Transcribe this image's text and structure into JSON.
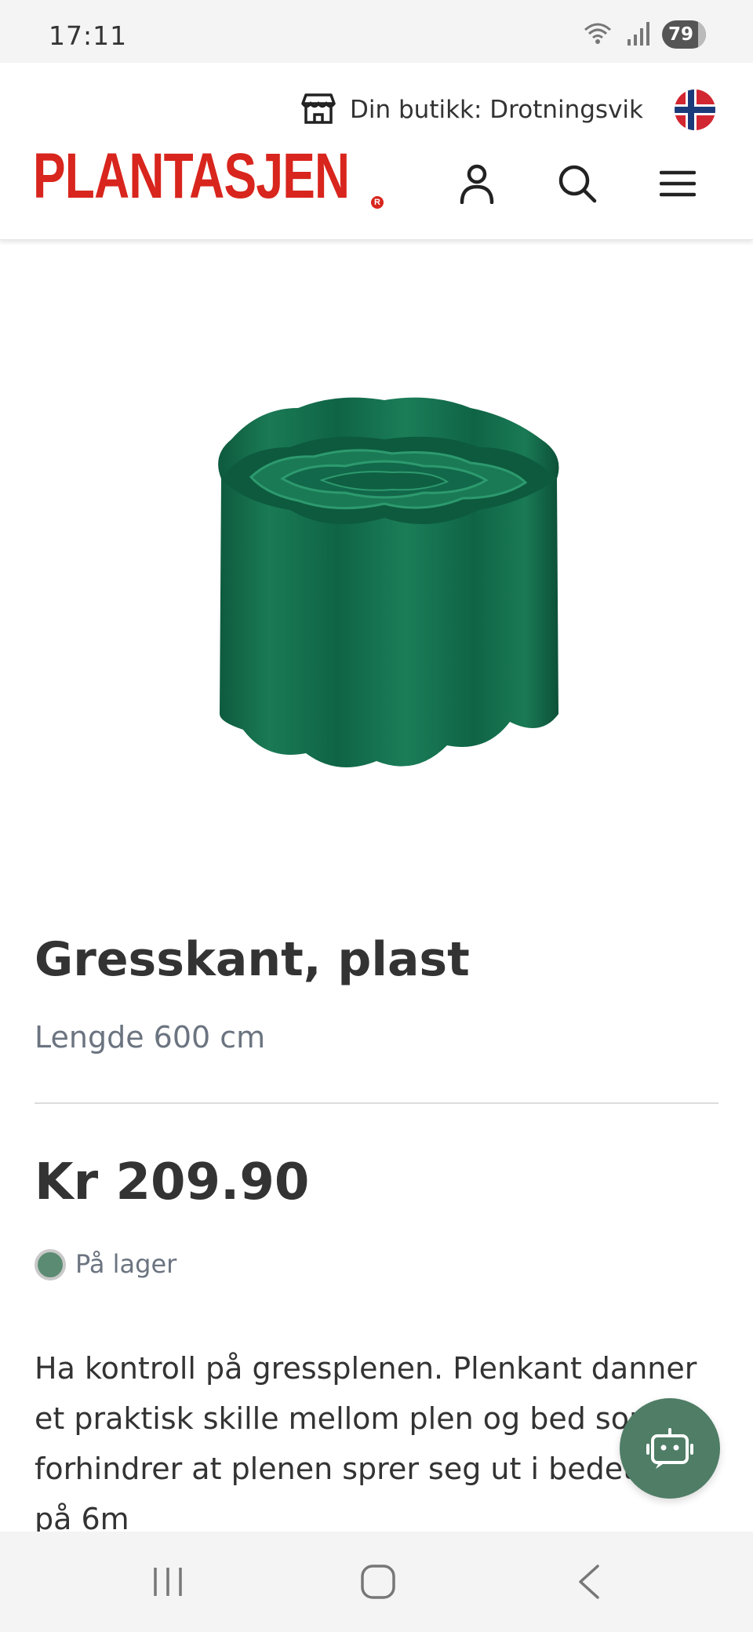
{
  "status_bar": {
    "time": "17:11",
    "battery": "79"
  },
  "header": {
    "store_label": "Din butikk: Drotningsvik",
    "logo_text": "PLANTASJEN",
    "icons": [
      "store-icon",
      "norway-flag-icon",
      "user-icon",
      "search-icon",
      "menu-icon"
    ]
  },
  "product": {
    "title": "Gresskant, plast",
    "subtitle": "Lengde 600 cm",
    "price": "Kr 209.90",
    "stock": "På lager",
    "description": "Ha kontroll på gressplenen. Plenkant danner et praktisk skille mellom plen og bed som forhindrer at plenen sprer seg ut i bedet. Rull på 6m"
  },
  "colors": {
    "brand": "#d8251d",
    "accent": "#4f7d66",
    "stock": "#5b8c73"
  },
  "nav_bar": {
    "icons": [
      "recent-apps-icon",
      "home-icon",
      "back-icon"
    ]
  }
}
